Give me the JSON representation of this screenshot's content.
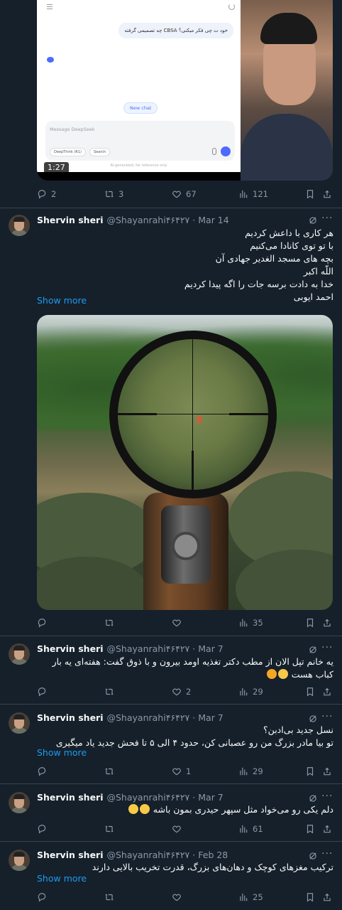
{
  "first_tweet": {
    "media": {
      "chat_bubble": "خود ت چی فکر میکنی؟ CBSA چه تصمیمی گرفته",
      "new_chat_label": "New chat",
      "input_placeholder": "Message DeepSeek",
      "deepthink_chip": "DeepThink (R1)",
      "search_chip": "Search",
      "footnote": "AI-generated, for reference only",
      "video_time": "1:27"
    },
    "actions": {
      "replies": "2",
      "retweets": "3",
      "likes": "67",
      "views": "121"
    }
  },
  "tweets": [
    {
      "author": "Shervin sheri",
      "handle": "@Shayanrahi۴۶۴۲۷",
      "date": "Mar 14",
      "text": "هر کاری با داعش کردیم\nبا تو توی کانادا می‌کنیم\nبچه های مسجد الغدیر جهادی آن\nاللّه اکبر\nخدا به دادت برسه جات را اگه پیدا کردیم\nاحمد ایوبی",
      "show_more": "Show more",
      "actions": {
        "replies": "",
        "retweets": "",
        "likes": "",
        "views": "35"
      }
    },
    {
      "author": "Shervin sheri",
      "handle": "@Shayanrahi۴۶۴۲۷",
      "date": "Mar 7",
      "text": "یه خانم تپل الان از مطب دکتر تغذیه اومد بیرون و با ذوق گفت: هفته‌ای یه بار کباب هست",
      "actions": {
        "replies": "",
        "retweets": "",
        "likes": "2",
        "views": "29"
      }
    },
    {
      "author": "Shervin sheri",
      "handle": "@Shayanrahi۴۶۴۲۷",
      "date": "Mar 7",
      "text": "نسل جدید بی‌ادبن؟\nتو بیا مادر بزرگ من رو عصبانی کن، حدود ۴ الی ۵ تا فحش جدید یاد میگیری",
      "show_more": "Show more",
      "actions": {
        "replies": "",
        "retweets": "",
        "likes": "1",
        "views": "29"
      }
    },
    {
      "author": "Shervin sheri",
      "handle": "@Shayanrahi۴۶۴۲۷",
      "date": "Mar 7",
      "text": "دلم یکی رو می‌خواد مثل سپهر حیدری بمون باشه",
      "actions": {
        "replies": "",
        "retweets": "",
        "likes": "",
        "views": "61"
      }
    },
    {
      "author": "Shervin sheri",
      "handle": "@Shayanrahi۴۶۴۲۷",
      "date": "Feb 28",
      "text": "ترکیب مغزهای کوچک و دهان‌های بزرگ، قدرت تخریب بالایی دارند",
      "show_more": "Show more",
      "actions": {
        "replies": "",
        "retweets": "",
        "likes": "",
        "views": "25"
      }
    }
  ],
  "colors": {
    "background": "#15202b",
    "text": "#f7f9f9",
    "muted": "#8b98a5",
    "link": "#1d9bf0",
    "divider": "#38444d"
  },
  "icons": [
    "reply-icon",
    "retweet-icon",
    "like-icon",
    "views-icon",
    "bookmark-icon",
    "share-icon",
    "grok-icon",
    "more-icon"
  ]
}
